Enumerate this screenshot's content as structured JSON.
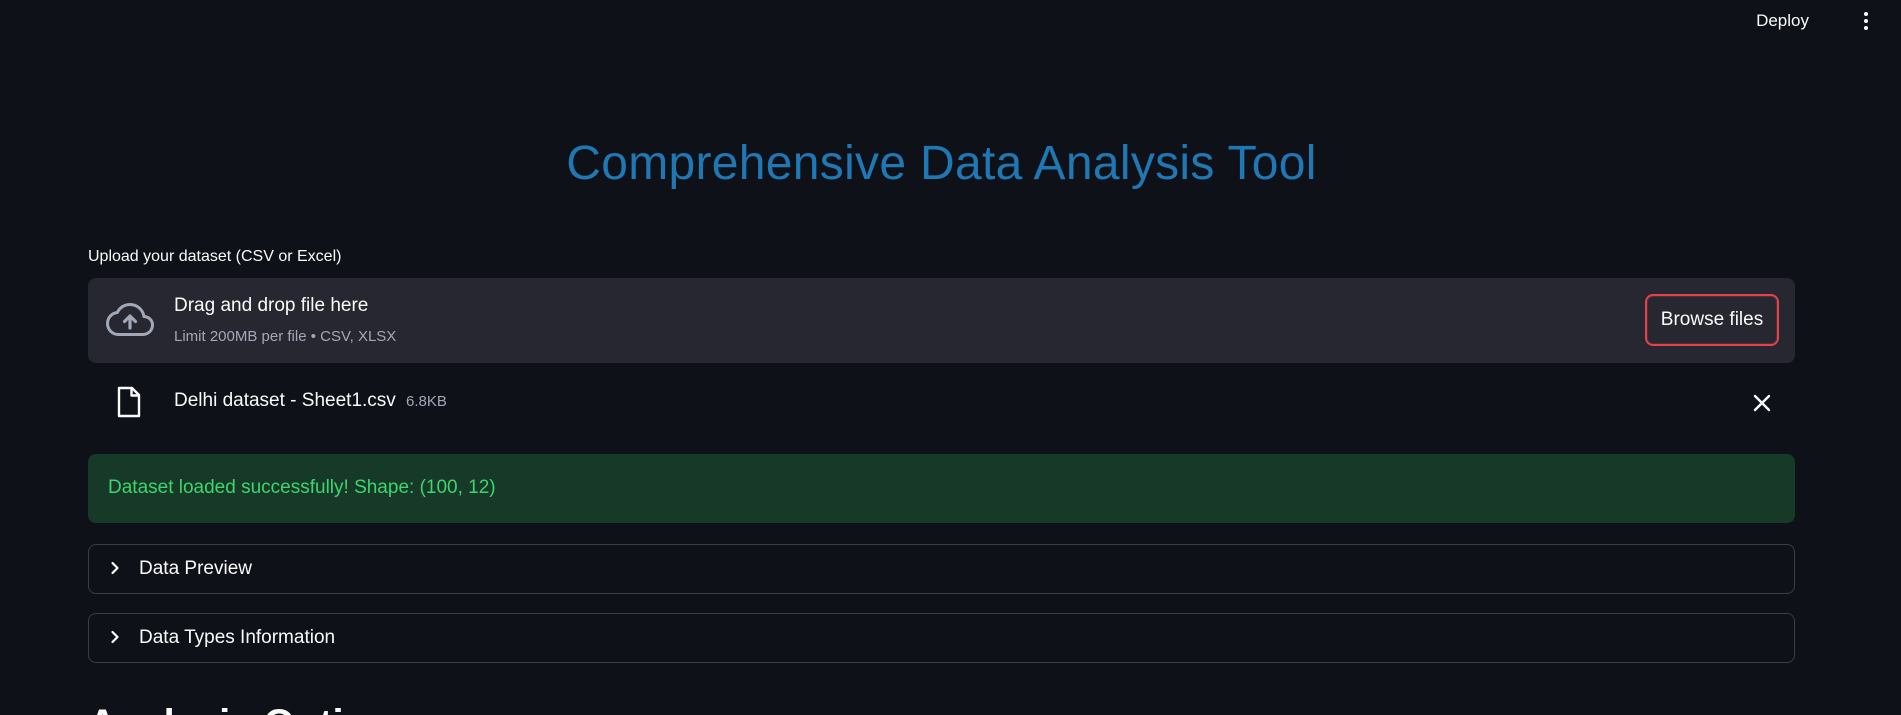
{
  "header": {
    "deploy_label": "Deploy",
    "menu_icon": "more-vertical-icon"
  },
  "main": {
    "title": "Comprehensive Data Analysis Tool",
    "uploader": {
      "label": "Upload your dataset (CSV or Excel)",
      "drag_text": "Drag and drop file here",
      "limit_text": "Limit 200MB per file • CSV, XLSX",
      "browse_label": "Browse files",
      "icon": "cloud-upload-icon"
    },
    "file": {
      "name": "Delhi dataset - Sheet1.csv",
      "size": "6.8KB",
      "icon": "file-icon"
    },
    "success_message": "Dataset loaded successfully! Shape: (100, 12)",
    "expanders": [
      {
        "label": "Data Preview"
      },
      {
        "label": "Data Types Information"
      }
    ],
    "section_heading": "Analysis Options"
  },
  "colors": {
    "background": "#0e1117",
    "title": "#1f77b4",
    "dropzone": "#262730",
    "success_bg": "#173928",
    "success_text": "#3dd56d",
    "browse_border": "#e0424f"
  }
}
